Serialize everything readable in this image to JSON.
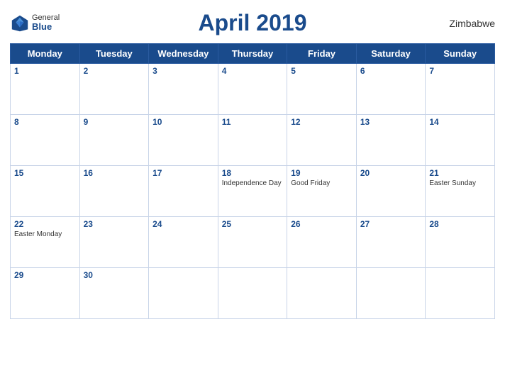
{
  "header": {
    "title": "April 2019",
    "country": "Zimbabwe",
    "logo": {
      "general": "General",
      "blue": "Blue"
    }
  },
  "weekdays": [
    "Monday",
    "Tuesday",
    "Wednesday",
    "Thursday",
    "Friday",
    "Saturday",
    "Sunday"
  ],
  "weeks": [
    [
      {
        "day": "1",
        "holiday": ""
      },
      {
        "day": "2",
        "holiday": ""
      },
      {
        "day": "3",
        "holiday": ""
      },
      {
        "day": "4",
        "holiday": ""
      },
      {
        "day": "5",
        "holiday": ""
      },
      {
        "day": "6",
        "holiday": ""
      },
      {
        "day": "7",
        "holiday": ""
      }
    ],
    [
      {
        "day": "8",
        "holiday": ""
      },
      {
        "day": "9",
        "holiday": ""
      },
      {
        "day": "10",
        "holiday": ""
      },
      {
        "day": "11",
        "holiday": ""
      },
      {
        "day": "12",
        "holiday": ""
      },
      {
        "day": "13",
        "holiday": ""
      },
      {
        "day": "14",
        "holiday": ""
      }
    ],
    [
      {
        "day": "15",
        "holiday": ""
      },
      {
        "day": "16",
        "holiday": ""
      },
      {
        "day": "17",
        "holiday": ""
      },
      {
        "day": "18",
        "holiday": "Independence Day"
      },
      {
        "day": "19",
        "holiday": "Good Friday"
      },
      {
        "day": "20",
        "holiday": ""
      },
      {
        "day": "21",
        "holiday": "Easter Sunday"
      }
    ],
    [
      {
        "day": "22",
        "holiday": "Easter Monday"
      },
      {
        "day": "23",
        "holiday": ""
      },
      {
        "day": "24",
        "holiday": ""
      },
      {
        "day": "25",
        "holiday": ""
      },
      {
        "day": "26",
        "holiday": ""
      },
      {
        "day": "27",
        "holiday": ""
      },
      {
        "day": "28",
        "holiday": ""
      }
    ],
    [
      {
        "day": "29",
        "holiday": ""
      },
      {
        "day": "30",
        "holiday": ""
      },
      {
        "day": "",
        "holiday": ""
      },
      {
        "day": "",
        "holiday": ""
      },
      {
        "day": "",
        "holiday": ""
      },
      {
        "day": "",
        "holiday": ""
      },
      {
        "day": "",
        "holiday": ""
      }
    ]
  ]
}
